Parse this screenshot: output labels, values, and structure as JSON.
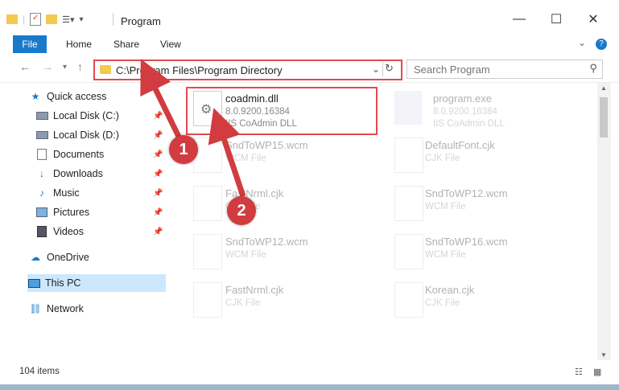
{
  "window": {
    "title": "Program",
    "minimize_label": "—",
    "maximize_label": "☐",
    "close_label": "✕",
    "help_label": "?",
    "expand_label": "⌄"
  },
  "ribbon": {
    "tabs": [
      {
        "label": "File"
      },
      {
        "label": "Home"
      },
      {
        "label": "Share"
      },
      {
        "label": "View"
      }
    ]
  },
  "address": {
    "path": "C:\\Program Files\\Program Directory",
    "search_placeholder": "Search Program"
  },
  "sidebar": {
    "items": [
      {
        "label": "Quick access",
        "icon": "star-icon"
      },
      {
        "label": "Local Disk (C:)",
        "icon": "drive-icon",
        "pinned": true
      },
      {
        "label": "Local Disk (D:)",
        "icon": "drive-icon",
        "pinned": true
      },
      {
        "label": "Documents",
        "icon": "documents-icon",
        "pinned": true
      },
      {
        "label": "Downloads",
        "icon": "download-icon",
        "pinned": true
      },
      {
        "label": "Music",
        "icon": "music-icon",
        "pinned": true
      },
      {
        "label": "Pictures",
        "icon": "pictures-icon",
        "pinned": true
      },
      {
        "label": "Videos",
        "icon": "videos-icon",
        "pinned": true
      },
      {
        "label": "OneDrive",
        "icon": "cloud-icon"
      },
      {
        "label": "This PC",
        "icon": "computer-icon",
        "selected": true
      },
      {
        "label": "Network",
        "icon": "network-icon"
      }
    ]
  },
  "files": [
    {
      "name": "coadmin.dll",
      "line2": "8.0.9200.16384",
      "line3": "IIS CoAdmin DLL",
      "highlighted": true
    },
    {
      "name": "program.exe",
      "line2": "8.0.9200.16384",
      "line3": "IIS CoAdmin DLL"
    },
    {
      "name": "SndToWP15.wcm",
      "line2": "WCM File",
      "line3": ""
    },
    {
      "name": "DefaultFont.cjk",
      "line2": "CJK File",
      "line3": ""
    },
    {
      "name": "FastNrml.cjk",
      "line2": "CJK File",
      "line3": ""
    },
    {
      "name": "SndToWP12.wcm",
      "line2": "WCM File",
      "line3": ""
    },
    {
      "name": "SndToWP12.wcm",
      "line2": "WCM File",
      "line3": ""
    },
    {
      "name": "SndToWP16.wcm",
      "line2": "WCM File",
      "line3": ""
    },
    {
      "name": "FastNrml.cjk",
      "line2": "CJK File",
      "line3": ""
    },
    {
      "name": "Korean.cjk",
      "line2": "CJK File",
      "line3": ""
    }
  ],
  "status": {
    "count": "104 items"
  },
  "callouts": [
    {
      "label": "1"
    },
    {
      "label": "2"
    }
  ],
  "colors": {
    "accent": "#1979ca",
    "highlight": "#e14a50",
    "selected": "#cce8ff"
  }
}
